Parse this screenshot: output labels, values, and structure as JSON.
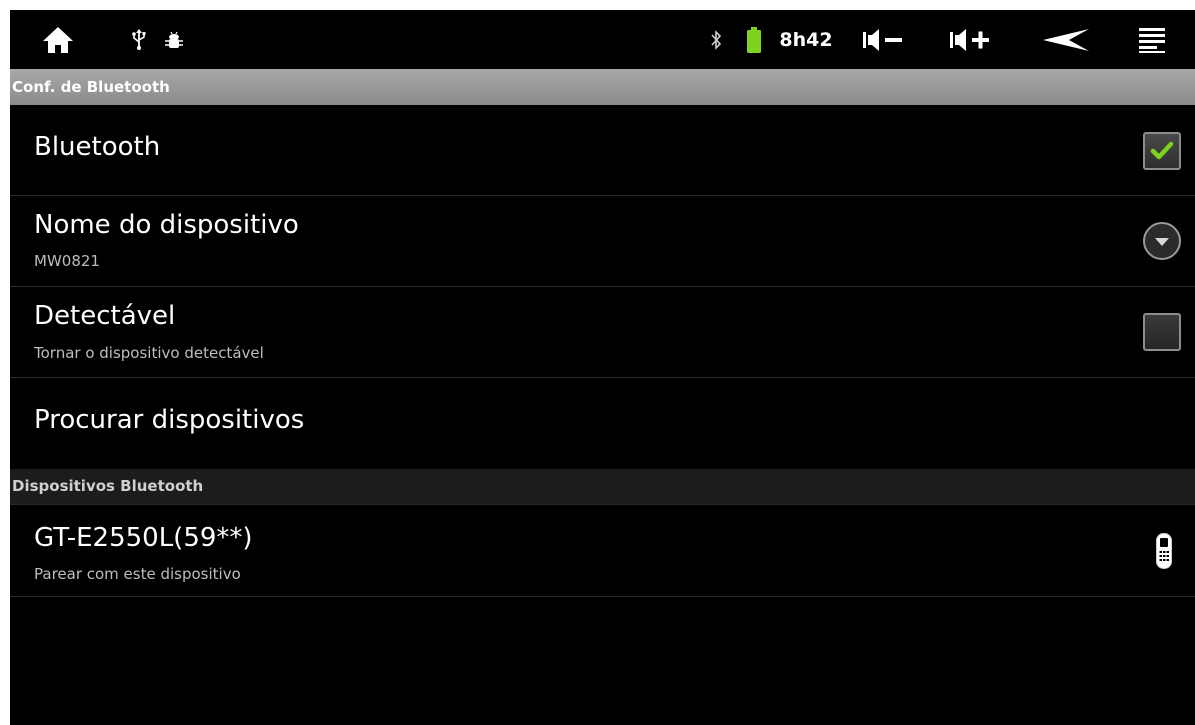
{
  "status_bar": {
    "icons": {
      "home": "home-icon",
      "usb": "usb-icon",
      "debug": "android-debug-icon",
      "bluetooth": "bluetooth-icon",
      "battery": "battery-icon",
      "volume_down": "volume-down-icon",
      "volume_up": "volume-up-icon",
      "back": "back-icon",
      "menu": "menu-icon"
    },
    "time": "8h42",
    "battery_color": "#7ed321"
  },
  "title_bar": {
    "title": "Conf. de Bluetooth"
  },
  "settings": {
    "bluetooth": {
      "title": "Bluetooth",
      "checked": true
    },
    "device_name": {
      "title": "Nome do dispositivo",
      "summary": "MW0821"
    },
    "discoverable": {
      "title": "Detectável",
      "summary": "Tornar o dispositivo detectável",
      "checked": false
    },
    "scan": {
      "title": "Procurar dispositivos"
    }
  },
  "devices_section": {
    "header": "Dispositivos Bluetooth",
    "items": [
      {
        "name": "GT-E2550L(59**)",
        "summary": "Parear com este dispositivo",
        "icon": "phone-icon"
      }
    ]
  },
  "colors": {
    "check": "#7ed321",
    "background": "#000000",
    "title_bar": "#999999"
  }
}
